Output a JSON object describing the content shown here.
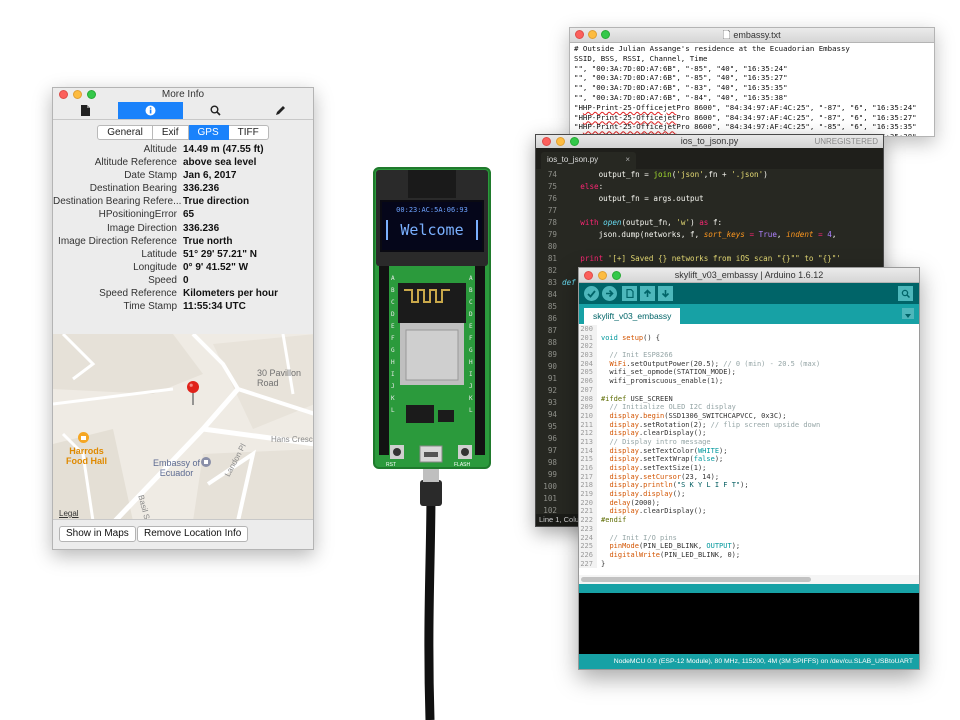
{
  "more_info": {
    "title": "More Info",
    "tabs": [
      "General",
      "Exif",
      "GPS",
      "TIFF"
    ],
    "active_tab": "GPS",
    "properties": [
      {
        "key": "Altitude",
        "value": "14.49 m (47.55 ft)"
      },
      {
        "key": "Altitude Reference",
        "value": "above sea level"
      },
      {
        "key": "Date Stamp",
        "value": "Jan 6, 2017"
      },
      {
        "key": "Destination Bearing",
        "value": "336.236"
      },
      {
        "key": "Destination Bearing Refere...",
        "value": "True direction"
      },
      {
        "key": "HPositioningError",
        "value": "65"
      },
      {
        "key": "Image Direction",
        "value": "336.236"
      },
      {
        "key": "Image Direction Reference",
        "value": "True north"
      },
      {
        "key": "Latitude",
        "value": "51° 29' 57.21\" N"
      },
      {
        "key": "Longitude",
        "value": "0° 9' 41.52\" W"
      },
      {
        "key": "Speed",
        "value": "0"
      },
      {
        "key": "Speed Reference",
        "value": "Kilometers per hour"
      },
      {
        "key": "Time Stamp",
        "value": "11:55:34 UTC"
      }
    ],
    "map": {
      "labels": {
        "pavillon": "30 Pavillon\nRoad",
        "hans": "Hans Cresc",
        "harrods": "Harrods\nFood Hall",
        "embassy": "Embassy of\nEcuador",
        "landon": "Landon Pl",
        "basil": "Basil St",
        "legal": "Legal"
      }
    },
    "buttons": {
      "show_in_maps": "Show in Maps",
      "remove_location": "Remove Location Info"
    }
  },
  "device": {
    "oled_line1": "00:23:AC:5A:06:93",
    "oled_line2": "Welcome",
    "labels": {
      "rst": "RST",
      "flash": "FLASH"
    }
  },
  "textedit": {
    "title": "embassy.txt",
    "lines": [
      "# Outside Julian Assange's residence at the Ecuadorian Embassy",
      "SSID, BSS, RSSI, Channel, Time",
      "\"\", \"00:3A:7D:0D:A7:6B\", \"-85\", \"40\", \"16:35:24\"",
      "\"\", \"00:3A:7D:0D:A7:6B\", \"-85\", \"40\", \"16:35:27\"",
      "\"\", \"00:3A:7D:0D:A7:6B\", \"-83\", \"40\", \"16:35:35\"",
      "\"\", \"00:3A:7D:0D:A7:6B\", \"-84\", \"40\", \"16:35:38\"",
      "\"HP-Print-25-Officejet Pro 8600\", \"84:34:97:AF:4C:25\", \"-87\", \"6\", \"16:35:24\"",
      "\"HP-Print-25-Officejet Pro 8600\", \"84:34:97:AF:4C:25\", \"-87\", \"6\", \"16:35:27\"",
      "\"HP-Print-25-Officejet Pro 8600\", \"84:34:97:AF:4C:25\", \"-85\", \"6\", \"16:35:35\"",
      "\"HP-Print-25-Officejet Pro 8600\", \"84:34:97:AF:4C:25\", \"-85\", \"6\", \"16:35:38\"",
      "\"BTWifi-with-FON\", \"C2:91:F9:42:ED:D6\", \"-81\", \"1\", \"16:35:24\""
    ]
  },
  "sublime": {
    "title": "ios_to_json.py",
    "unregistered": "UNREGISTERED",
    "tab_label": "ios_to_json.py",
    "line_numbers": [
      "74",
      "75",
      "76",
      "77",
      "78",
      "79",
      "80",
      "81",
      "82",
      "83",
      "84",
      "85",
      "86",
      "87",
      "88",
      "89",
      "90",
      "91",
      "92",
      "93",
      "94",
      "95",
      "96",
      "97",
      "98",
      "99",
      "100",
      "101",
      "102",
      "103"
    ],
    "status": "Line 1, Colu"
  },
  "arduino": {
    "title": "skylift_v03_embassy | Arduino 1.6.12",
    "tab_label": "skylift_v03_embassy",
    "line_numbers": [
      "200",
      "201",
      "202",
      "203",
      "204",
      "205",
      "206",
      "207",
      "208",
      "209",
      "210",
      "211",
      "212",
      "213",
      "214",
      "215",
      "216",
      "217",
      "218",
      "219",
      "220",
      "221",
      "222",
      "223",
      "224",
      "225",
      "226",
      "227"
    ],
    "status": "NodeMCU 0.9 (ESP-12 Module), 80 MHz, 115200, 4M (3M SPIFFS) on /dev/cu.SLAB_USBtoUART"
  }
}
